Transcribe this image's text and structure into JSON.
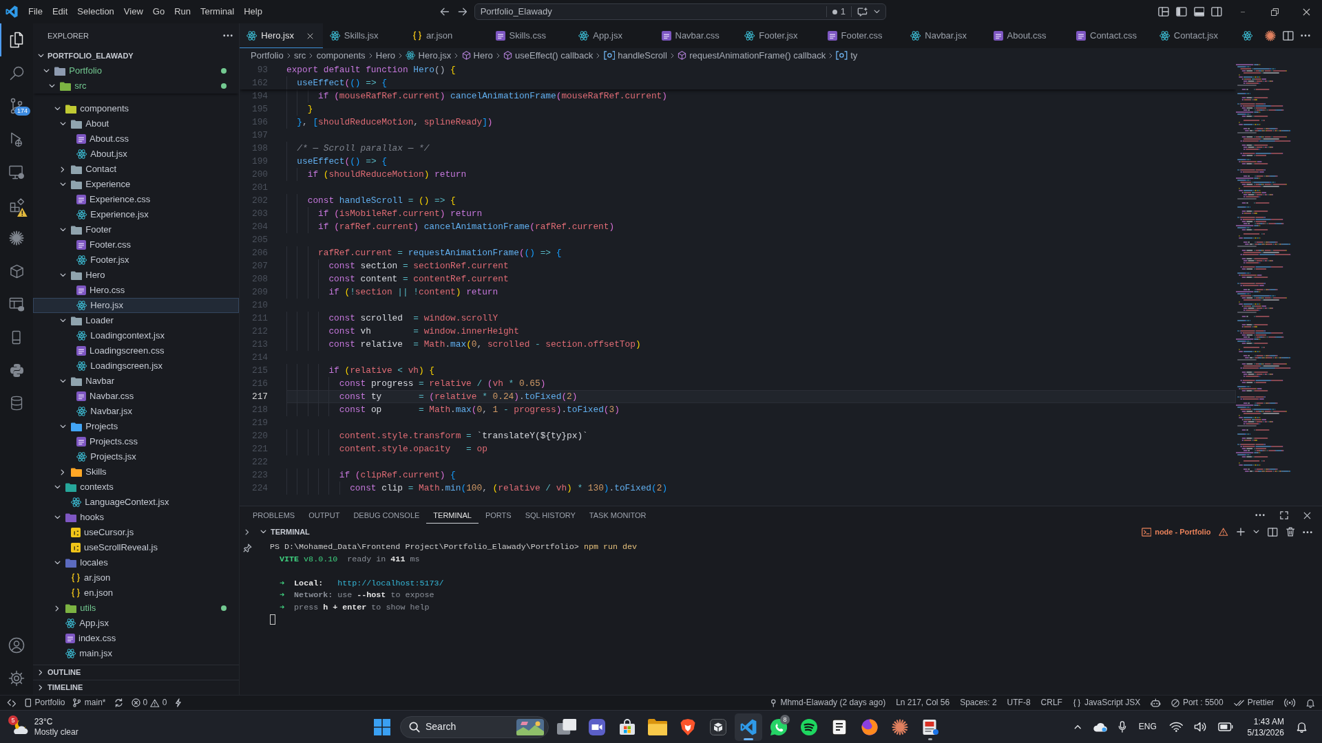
{
  "title_bar": {
    "menu": [
      "File",
      "Edit",
      "Selection",
      "View",
      "Go",
      "Run",
      "Terminal",
      "Help"
    ],
    "command_center": {
      "text": "Portfolio_Elawady",
      "count": "1"
    },
    "panels": [
      {
        "kind": "sidebar-left",
        "on": true
      },
      {
        "kind": "panel",
        "on": true
      },
      {
        "kind": "sidebar-right",
        "on": false
      }
    ]
  },
  "activity_bar": {
    "items": [
      {
        "kind": "explorer",
        "selected": true,
        "alert": false
      },
      {
        "kind": "search",
        "selected": false,
        "alert": false
      },
      {
        "kind": "source-control",
        "selected": false,
        "alert": false,
        "badge": "174"
      },
      {
        "kind": "run-debug",
        "selected": false,
        "alert": false
      },
      {
        "kind": "remote",
        "selected": false,
        "alert": false
      },
      {
        "kind": "extensions",
        "selected": false,
        "alert": true
      },
      {
        "kind": "burst",
        "selected": false,
        "alert": false
      },
      {
        "kind": "box",
        "selected": false,
        "alert": false
      },
      {
        "kind": "table",
        "selected": false,
        "alert": false
      },
      {
        "kind": "device",
        "selected": false,
        "alert": false
      },
      {
        "kind": "python",
        "selected": false,
        "alert": false
      },
      {
        "kind": "database",
        "selected": false,
        "alert": false
      }
    ]
  },
  "sidebar": {
    "title": "EXPLORER",
    "sections": [
      {
        "label": "PORTFOLIO_ELAWADY",
        "expanded": true,
        "tree": [
          {
            "label": "Portfolio",
            "kind": "folder",
            "color": "#8e9bb0",
            "expanded": true,
            "selected": false,
            "changed": true,
            "children": [
              {
                "label": "src",
                "kind": "folder",
                "color": "#7cb342",
                "expanded": true,
                "selected": false,
                "changed": true,
                "children": [
                  {
                    "label": "components",
                    "kind": "folder",
                    "color": "#c0ca33",
                    "expanded": true,
                    "selected": false,
                    "changed": false,
                    "children": [
                      {
                        "label": "About",
                        "kind": "folder",
                        "color": "#90a4ae",
                        "expanded": true,
                        "selected": false,
                        "changed": false,
                        "children": [
                          {
                            "label": "About.css",
                            "kind": "css",
                            "selected": false,
                            "changed": false
                          },
                          {
                            "label": "About.jsx",
                            "kind": "react",
                            "selected": false,
                            "changed": false
                          }
                        ]
                      },
                      {
                        "label": "Contact",
                        "kind": "folder",
                        "color": "#90a4ae",
                        "expanded": false,
                        "selected": false,
                        "changed": false
                      },
                      {
                        "label": "Experience",
                        "kind": "folder",
                        "color": "#90a4ae",
                        "expanded": true,
                        "selected": false,
                        "changed": false,
                        "children": [
                          {
                            "label": "Experience.css",
                            "kind": "css",
                            "selected": false,
                            "changed": false
                          },
                          {
                            "label": "Experience.jsx",
                            "kind": "react",
                            "selected": false,
                            "changed": false
                          }
                        ]
                      },
                      {
                        "label": "Footer",
                        "kind": "folder",
                        "color": "#90a4ae",
                        "expanded": true,
                        "selected": false,
                        "changed": false,
                        "children": [
                          {
                            "label": "Footer.css",
                            "kind": "css",
                            "selected": false,
                            "changed": false
                          },
                          {
                            "label": "Footer.jsx",
                            "kind": "react",
                            "selected": false,
                            "changed": false
                          }
                        ]
                      },
                      {
                        "label": "Hero",
                        "kind": "folder",
                        "color": "#90a4ae",
                        "expanded": true,
                        "selected": false,
                        "changed": false,
                        "children": [
                          {
                            "label": "Hero.css",
                            "kind": "css",
                            "selected": false,
                            "changed": false
                          },
                          {
                            "label": "Hero.jsx",
                            "kind": "react",
                            "selected": true,
                            "changed": false
                          }
                        ]
                      },
                      {
                        "label": "Loader",
                        "kind": "folder",
                        "color": "#90a4ae",
                        "expanded": true,
                        "selected": false,
                        "changed": false,
                        "children": [
                          {
                            "label": "Loadingcontext.jsx",
                            "kind": "react",
                            "selected": false,
                            "changed": false
                          },
                          {
                            "label": "Loadingscreen.css",
                            "kind": "css",
                            "selected": false,
                            "changed": false
                          },
                          {
                            "label": "Loadingscreen.jsx",
                            "kind": "react",
                            "selected": false,
                            "changed": false
                          }
                        ]
                      },
                      {
                        "label": "Navbar",
                        "kind": "folder",
                        "color": "#90a4ae",
                        "expanded": true,
                        "selected": false,
                        "changed": false,
                        "children": [
                          {
                            "label": "Navbar.css",
                            "kind": "css",
                            "selected": false,
                            "changed": false
                          },
                          {
                            "label": "Navbar.jsx",
                            "kind": "react",
                            "selected": false,
                            "changed": false
                          }
                        ]
                      },
                      {
                        "label": "Projects",
                        "kind": "folder",
                        "color": "#42a5f5",
                        "expanded": true,
                        "selected": false,
                        "changed": false,
                        "children": [
                          {
                            "label": "Projects.css",
                            "kind": "css",
                            "selected": false,
                            "changed": false
                          },
                          {
                            "label": "Projects.jsx",
                            "kind": "react",
                            "selected": false,
                            "changed": false
                          }
                        ]
                      },
                      {
                        "label": "Skills",
                        "kind": "folder",
                        "color": "#ffa726",
                        "expanded": false,
                        "selected": false,
                        "changed": false
                      }
                    ]
                  },
                  {
                    "label": "contexts",
                    "kind": "folder",
                    "color": "#26a69a",
                    "expanded": true,
                    "selected": false,
                    "changed": false,
                    "children": [
                      {
                        "label": "LanguageContext.jsx",
                        "kind": "react",
                        "selected": false,
                        "changed": false
                      }
                    ]
                  },
                  {
                    "label": "hooks",
                    "kind": "folder",
                    "color": "#7e57c2",
                    "expanded": true,
                    "selected": false,
                    "changed": false,
                    "children": [
                      {
                        "label": "useCursor.js",
                        "kind": "js",
                        "selected": false,
                        "changed": false
                      },
                      {
                        "label": "useScrollReveal.js",
                        "kind": "js",
                        "selected": false,
                        "changed": false
                      }
                    ]
                  },
                  {
                    "label": "locales",
                    "kind": "folder",
                    "color": "#5c6bc0",
                    "expanded": true,
                    "selected": false,
                    "changed": false,
                    "children": [
                      {
                        "label": "ar.json",
                        "kind": "json",
                        "selected": false,
                        "changed": false
                      },
                      {
                        "label": "en.json",
                        "kind": "json",
                        "selected": false,
                        "changed": false
                      }
                    ]
                  },
                  {
                    "label": "utils",
                    "kind": "folder",
                    "color": "#7cb342",
                    "expanded": false,
                    "selected": false,
                    "changed": true
                  },
                  {
                    "label": "App.jsx",
                    "kind": "react",
                    "selected": false,
                    "changed": false
                  },
                  {
                    "label": "index.css",
                    "kind": "css",
                    "selected": false,
                    "changed": false
                  },
                  {
                    "label": "main.jsx",
                    "kind": "react",
                    "selected": false,
                    "changed": false
                  }
                ]
              }
            ]
          }
        ]
      },
      {
        "label": "OUTLINE",
        "expanded": false
      },
      {
        "label": "TIMELINE",
        "expanded": false
      }
    ]
  },
  "editor": {
    "tabs": [
      {
        "label": "Hero.jsx",
        "kind": "react",
        "selected": true
      },
      {
        "label": "Skills.jsx",
        "kind": "react",
        "selected": false
      },
      {
        "label": "ar.json",
        "kind": "json",
        "selected": false
      },
      {
        "label": "Skills.css",
        "kind": "css",
        "selected": false
      },
      {
        "label": "App.jsx",
        "kind": "react",
        "selected": false
      },
      {
        "label": "Navbar.css",
        "kind": "css",
        "selected": false
      },
      {
        "label": "Footer.jsx",
        "kind": "react",
        "selected": false
      },
      {
        "label": "Footer.css",
        "kind": "css",
        "selected": false
      },
      {
        "label": "Navbar.jsx",
        "kind": "react",
        "selected": false
      },
      {
        "label": "About.css",
        "kind": "css",
        "selected": false
      },
      {
        "label": "Contact.css",
        "kind": "css",
        "selected": false
      },
      {
        "label": "Contact.jsx",
        "kind": "react",
        "selected": false
      },
      {
        "kind": "react",
        "selected": false
      }
    ],
    "breadcrumb": [
      {
        "label": "Portfolio",
        "kind": "folder"
      },
      {
        "label": "src",
        "kind": "folder"
      },
      {
        "label": "components",
        "kind": "folder"
      },
      {
        "label": "Hero",
        "kind": "folder"
      },
      {
        "label": "Hero.jsx",
        "kind": "react"
      },
      {
        "label": "Hero",
        "kind": "function"
      },
      {
        "label": "useEffect() callback",
        "kind": "function"
      },
      {
        "label": "handleScroll",
        "kind": "variable"
      },
      {
        "label": "requestAnimationFrame() callback",
        "kind": "function"
      },
      {
        "label": "ty",
        "kind": "variable"
      }
    ],
    "sticky_lines": [
      {
        "number": "93",
        "current": false,
        "tokens": [
          {
            "kind": "keyword",
            "text": "export default function "
          },
          {
            "kind": "function",
            "text": "Hero"
          },
          {
            "kind": "punctuation",
            "text": "() "
          },
          {
            "kind": "brace1",
            "text": "{"
          }
        ]
      },
      {
        "number": "162",
        "current": false,
        "tokens": [
          {
            "kind": "function",
            "text": "  useEffect"
          },
          {
            "kind": "brace2",
            "text": "("
          },
          {
            "kind": "brace3",
            "text": "()"
          },
          {
            "kind": "operator",
            "text": " => "
          },
          {
            "kind": "brace3",
            "text": "{"
          }
        ]
      }
    ],
    "lines": [
      {
        "number": "194",
        "current": false,
        "tokens": [
          {
            "kind": "keyword",
            "text": "      if "
          },
          {
            "kind": "brace2",
            "text": "("
          },
          {
            "kind": "variable",
            "text": "mouseRafRef.current"
          },
          {
            "kind": "brace2",
            "text": ") "
          },
          {
            "kind": "function",
            "text": "cancelAnimationFrame"
          },
          {
            "kind": "brace2",
            "text": "("
          },
          {
            "kind": "variable",
            "text": "mouseRafRef.current"
          },
          {
            "kind": "brace2",
            "text": ")"
          }
        ]
      },
      {
        "number": "195",
        "current": false,
        "tokens": [
          {
            "kind": "brace1",
            "text": "    }"
          }
        ]
      },
      {
        "number": "196",
        "current": false,
        "tokens": [
          {
            "kind": "brace3",
            "text": "  }"
          },
          {
            "kind": "punctuation",
            "text": ", "
          },
          {
            "kind": "brace3",
            "text": "["
          },
          {
            "kind": "variable",
            "text": "shouldReduceMotion"
          },
          {
            "kind": "punctuation",
            "text": ", "
          },
          {
            "kind": "variable",
            "text": "splineReady"
          },
          {
            "kind": "brace3",
            "text": "]"
          },
          {
            "kind": "brace2",
            "text": ")"
          }
        ]
      },
      {
        "number": "197",
        "current": false
      },
      {
        "number": "198",
        "current": false,
        "tokens": [
          {
            "kind": "comment",
            "text": "  /* — Scroll parallax — */"
          }
        ]
      },
      {
        "number": "199",
        "current": false,
        "tokens": [
          {
            "kind": "function",
            "text": "  useEffect"
          },
          {
            "kind": "brace2",
            "text": "("
          },
          {
            "kind": "brace3",
            "text": "()"
          },
          {
            "kind": "operator",
            "text": " => "
          },
          {
            "kind": "brace3",
            "text": "{"
          }
        ]
      },
      {
        "number": "200",
        "current": false,
        "tokens": [
          {
            "kind": "keyword",
            "text": "    if "
          },
          {
            "kind": "brace1",
            "text": "("
          },
          {
            "kind": "variable",
            "text": "shouldReduceMotion"
          },
          {
            "kind": "brace1",
            "text": ") "
          },
          {
            "kind": "keyword",
            "text": "return"
          }
        ]
      },
      {
        "number": "201",
        "current": false
      },
      {
        "number": "202",
        "current": false,
        "tokens": [
          {
            "kind": "keyword",
            "text": "    const "
          },
          {
            "kind": "function",
            "text": "handleScroll"
          },
          {
            "kind": "operator",
            "text": " = "
          },
          {
            "kind": "brace1",
            "text": "() "
          },
          {
            "kind": "operator",
            "text": "=> "
          },
          {
            "kind": "brace1",
            "text": "{"
          }
        ]
      },
      {
        "number": "203",
        "current": false,
        "tokens": [
          {
            "kind": "keyword",
            "text": "      if "
          },
          {
            "kind": "brace2",
            "text": "("
          },
          {
            "kind": "variable",
            "text": "isMobileRef.current"
          },
          {
            "kind": "brace2",
            "text": ") "
          },
          {
            "kind": "keyword",
            "text": "return"
          }
        ]
      },
      {
        "number": "204",
        "current": false,
        "tokens": [
          {
            "kind": "keyword",
            "text": "      if "
          },
          {
            "kind": "brace2",
            "text": "("
          },
          {
            "kind": "variable",
            "text": "rafRef.current"
          },
          {
            "kind": "brace2",
            "text": ") "
          },
          {
            "kind": "function",
            "text": "cancelAnimationFrame"
          },
          {
            "kind": "brace2",
            "text": "("
          },
          {
            "kind": "variable",
            "text": "rafRef.current"
          },
          {
            "kind": "brace2",
            "text": ")"
          }
        ]
      },
      {
        "number": "205",
        "current": false
      },
      {
        "number": "206",
        "current": false,
        "tokens": [
          {
            "kind": "variable",
            "text": "      rafRef.current"
          },
          {
            "kind": "operator",
            "text": " = "
          },
          {
            "kind": "function",
            "text": "requestAnimationFrame"
          },
          {
            "kind": "brace2",
            "text": "("
          },
          {
            "kind": "brace3",
            "text": "() "
          },
          {
            "kind": "operator",
            "text": "=> "
          },
          {
            "kind": "brace3",
            "text": "{"
          }
        ]
      },
      {
        "number": "207",
        "current": false,
        "tokens": [
          {
            "kind": "keyword",
            "text": "        const "
          },
          {
            "kind": "name",
            "text": "section"
          },
          {
            "kind": "operator",
            "text": " = "
          },
          {
            "kind": "variable",
            "text": "sectionRef.current"
          }
        ]
      },
      {
        "number": "208",
        "current": false,
        "tokens": [
          {
            "kind": "keyword",
            "text": "        const "
          },
          {
            "kind": "name",
            "text": "content"
          },
          {
            "kind": "operator",
            "text": " = "
          },
          {
            "kind": "variable",
            "text": "contentRef.current"
          }
        ]
      },
      {
        "number": "209",
        "current": false,
        "tokens": [
          {
            "kind": "keyword",
            "text": "        if "
          },
          {
            "kind": "brace1",
            "text": "("
          },
          {
            "kind": "operator",
            "text": "!"
          },
          {
            "kind": "variable",
            "text": "section"
          },
          {
            "kind": "operator",
            "text": " || !"
          },
          {
            "kind": "variable",
            "text": "content"
          },
          {
            "kind": "brace1",
            "text": ") "
          },
          {
            "kind": "keyword",
            "text": "return"
          }
        ]
      },
      {
        "number": "210",
        "current": false
      },
      {
        "number": "211",
        "current": false,
        "tokens": [
          {
            "kind": "keyword",
            "text": "        const "
          },
          {
            "kind": "name",
            "text": "scrolled "
          },
          {
            "kind": "operator",
            "text": " = "
          },
          {
            "kind": "variable",
            "text": "window.scrollY"
          }
        ]
      },
      {
        "number": "212",
        "current": false,
        "tokens": [
          {
            "kind": "keyword",
            "text": "        const "
          },
          {
            "kind": "name",
            "text": "vh       "
          },
          {
            "kind": "operator",
            "text": " = "
          },
          {
            "kind": "variable",
            "text": "window.innerHeight"
          }
        ]
      },
      {
        "number": "213",
        "current": false,
        "tokens": [
          {
            "kind": "keyword",
            "text": "        const "
          },
          {
            "kind": "name",
            "text": "relative "
          },
          {
            "kind": "operator",
            "text": " = "
          },
          {
            "kind": "variable",
            "text": "Math"
          },
          {
            "kind": "punctuation",
            "text": "."
          },
          {
            "kind": "function",
            "text": "max"
          },
          {
            "kind": "brace1",
            "text": "("
          },
          {
            "kind": "number",
            "text": "0"
          },
          {
            "kind": "punctuation",
            "text": ", "
          },
          {
            "kind": "variable",
            "text": "scrolled"
          },
          {
            "kind": "operator",
            "text": " - "
          },
          {
            "kind": "variable",
            "text": "section.offsetTop"
          },
          {
            "kind": "brace1",
            "text": ")"
          }
        ]
      },
      {
        "number": "214",
        "current": false
      },
      {
        "number": "215",
        "current": false,
        "tokens": [
          {
            "kind": "keyword",
            "text": "        if "
          },
          {
            "kind": "brace1",
            "text": "("
          },
          {
            "kind": "variable",
            "text": "relative"
          },
          {
            "kind": "operator",
            "text": " < "
          },
          {
            "kind": "variable",
            "text": "vh"
          },
          {
            "kind": "brace1",
            "text": ") {"
          }
        ]
      },
      {
        "number": "216",
        "current": false,
        "tokens": [
          {
            "kind": "keyword",
            "text": "          const "
          },
          {
            "kind": "name",
            "text": "progress"
          },
          {
            "kind": "operator",
            "text": " = "
          },
          {
            "kind": "variable",
            "text": "relative"
          },
          {
            "kind": "operator",
            "text": " / "
          },
          {
            "kind": "brace2",
            "text": "("
          },
          {
            "kind": "variable",
            "text": "vh"
          },
          {
            "kind": "operator",
            "text": " * "
          },
          {
            "kind": "number",
            "text": "0.65"
          },
          {
            "kind": "brace2",
            "text": ")"
          }
        ]
      },
      {
        "number": "217",
        "current": true,
        "tokens": [
          {
            "kind": "keyword",
            "text": "          const "
          },
          {
            "kind": "name",
            "text": "ty      "
          },
          {
            "kind": "operator",
            "text": " = "
          },
          {
            "kind": "brace2",
            "text": "("
          },
          {
            "kind": "variable",
            "text": "relative"
          },
          {
            "kind": "operator",
            "text": " * "
          },
          {
            "kind": "number",
            "text": "0.24"
          },
          {
            "kind": "brace2",
            "text": ")"
          },
          {
            "kind": "punctuation",
            "text": "."
          },
          {
            "kind": "function",
            "text": "toFixed"
          },
          {
            "kind": "brace2",
            "text": "("
          },
          {
            "kind": "number",
            "text": "2"
          },
          {
            "kind": "brace2",
            "text": ")"
          }
        ]
      },
      {
        "number": "218",
        "current": false,
        "tokens": [
          {
            "kind": "keyword",
            "text": "          const "
          },
          {
            "kind": "name",
            "text": "op      "
          },
          {
            "kind": "operator",
            "text": " = "
          },
          {
            "kind": "variable",
            "text": "Math"
          },
          {
            "kind": "punctuation",
            "text": "."
          },
          {
            "kind": "function",
            "text": "max"
          },
          {
            "kind": "brace2",
            "text": "("
          },
          {
            "kind": "number",
            "text": "0"
          },
          {
            "kind": "punctuation",
            "text": ", "
          },
          {
            "kind": "number",
            "text": "1"
          },
          {
            "kind": "operator",
            "text": " - "
          },
          {
            "kind": "variable",
            "text": "progress"
          },
          {
            "kind": "brace2",
            "text": ")"
          },
          {
            "kind": "punctuation",
            "text": "."
          },
          {
            "kind": "function",
            "text": "toFixed"
          },
          {
            "kind": "brace2",
            "text": "("
          },
          {
            "kind": "number",
            "text": "3"
          },
          {
            "kind": "brace2",
            "text": ")"
          }
        ]
      },
      {
        "number": "219",
        "current": false
      },
      {
        "number": "220",
        "current": false,
        "tokens": [
          {
            "kind": "variable",
            "text": "          content.style.transform"
          },
          {
            "kind": "operator",
            "text": " = "
          },
          {
            "kind": "string",
            "text": "`translateY(${ty}px)`"
          }
        ]
      },
      {
        "number": "221",
        "current": false,
        "tokens": [
          {
            "kind": "variable",
            "text": "          content.style.opacity"
          },
          {
            "kind": "operator",
            "text": "   = "
          },
          {
            "kind": "variable",
            "text": "op"
          }
        ]
      },
      {
        "number": "222",
        "current": false
      },
      {
        "number": "223",
        "current": false,
        "tokens": [
          {
            "kind": "keyword",
            "text": "          if "
          },
          {
            "kind": "brace2",
            "text": "("
          },
          {
            "kind": "variable",
            "text": "clipRef.current"
          },
          {
            "kind": "brace2",
            "text": ") "
          },
          {
            "kind": "brace3",
            "text": "{"
          }
        ]
      },
      {
        "number": "224",
        "current": false,
        "tokens": [
          {
            "kind": "keyword",
            "text": "            const "
          },
          {
            "kind": "name",
            "text": "clip"
          },
          {
            "kind": "operator",
            "text": " = "
          },
          {
            "kind": "variable",
            "text": "Math"
          },
          {
            "kind": "punctuation",
            "text": "."
          },
          {
            "kind": "function",
            "text": "min"
          },
          {
            "kind": "brace3",
            "text": "("
          },
          {
            "kind": "number",
            "text": "100"
          },
          {
            "kind": "punctuation",
            "text": ", "
          },
          {
            "kind": "brace1",
            "text": "("
          },
          {
            "kind": "variable",
            "text": "relative"
          },
          {
            "kind": "operator",
            "text": " / "
          },
          {
            "kind": "variable",
            "text": "vh"
          },
          {
            "kind": "brace1",
            "text": ")"
          },
          {
            "kind": "operator",
            "text": " * "
          },
          {
            "kind": "number",
            "text": "130"
          },
          {
            "kind": "brace3",
            "text": ")"
          },
          {
            "kind": "punctuation",
            "text": "."
          },
          {
            "kind": "function",
            "text": "toFixed"
          },
          {
            "kind": "brace3",
            "text": "("
          },
          {
            "kind": "number",
            "text": "2"
          },
          {
            "kind": "brace3",
            "text": ")"
          }
        ]
      }
    ]
  },
  "panel": {
    "tabs": [
      {
        "label": "PROBLEMS",
        "selected": false
      },
      {
        "label": "OUTPUT",
        "selected": false
      },
      {
        "label": "DEBUG CONSOLE",
        "selected": false
      },
      {
        "label": "TERMINAL",
        "selected": true
      },
      {
        "label": "PORTS",
        "selected": false
      },
      {
        "label": "SQL HISTORY",
        "selected": false
      },
      {
        "label": "TASK MONITOR",
        "selected": false
      }
    ],
    "terminal": {
      "title": "TERMINAL",
      "expanded": true,
      "instance": "node - Portfolio",
      "warning": true,
      "cursor": true,
      "lines": [
        {
          "kind": "prompt",
          "segments": [
            {
              "kind": "prompt",
              "text": "PS D:\\Mohamed_Data\\Frontend Project\\Portfolio_Elawady\\Portfolio> "
            },
            {
              "kind": "command",
              "text": "npm run dev"
            }
          ]
        },
        {
          "kind": "output",
          "segments": [
            {
              "kind": "brand",
              "text": "  VITE"
            },
            {
              "kind": "version",
              "text": " v8.0.10"
            },
            {
              "kind": "dim",
              "text": "  ready in "
            },
            {
              "kind": "strong",
              "text": "411"
            },
            {
              "kind": "dim",
              "text": " ms"
            }
          ]
        },
        {
          "kind": "blank"
        },
        {
          "kind": "output",
          "segments": [
            {
              "kind": "arrow",
              "text": "  ➜  "
            },
            {
              "kind": "strong",
              "text": "Local:"
            },
            {
              "kind": "url",
              "text": "   http://localhost:5173/"
            }
          ]
        },
        {
          "kind": "output",
          "segments": [
            {
              "kind": "arrow",
              "text": "  ➜  "
            },
            {
              "kind": "dim-strong",
              "text": "Network:"
            },
            {
              "kind": "dim",
              "text": " use "
            },
            {
              "kind": "strong",
              "text": "--host"
            },
            {
              "kind": "dim",
              "text": " to expose"
            }
          ]
        },
        {
          "kind": "output",
          "segments": [
            {
              "kind": "arrow",
              "text": "  ➜  "
            },
            {
              "kind": "dim",
              "text": "press "
            },
            {
              "kind": "strong",
              "text": "h + enter"
            },
            {
              "kind": "dim",
              "text": " to show help"
            }
          ]
        }
      ]
    }
  },
  "status_bar": {
    "left": [
      {
        "kind": "remote"
      },
      {
        "kind": "project",
        "text": "Portfolio"
      },
      {
        "kind": "branch",
        "text": "main*"
      },
      {
        "kind": "sync"
      },
      {
        "kind": "problems",
        "errors": "0",
        "warnings": "0"
      },
      {
        "kind": "lightning"
      }
    ],
    "right": [
      {
        "kind": "blame",
        "text": "Mhmd-Elawady (2 days ago)"
      },
      {
        "kind": "plain",
        "text": "Ln 217, Col 56"
      },
      {
        "kind": "plain",
        "text": "Spaces: 2"
      },
      {
        "kind": "plain",
        "text": "UTF-8"
      },
      {
        "kind": "plain",
        "text": "CRLF"
      },
      {
        "kind": "language",
        "text": "JavaScript JSX"
      },
      {
        "kind": "robot"
      },
      {
        "kind": "port",
        "text": "Port : 5500"
      },
      {
        "kind": "prettier",
        "text": "Prettier"
      },
      {
        "kind": "broadcast"
      },
      {
        "kind": "bell"
      }
    ]
  },
  "taskbar": {
    "weather": {
      "badge": "5",
      "temperature": "23°C",
      "condition": "Mostly clear"
    },
    "apps": [
      {
        "kind": "start",
        "active": false,
        "running": false
      },
      {
        "kind": "search",
        "placeholder": "Search",
        "active": false
      },
      {
        "kind": "task-view",
        "active": false,
        "running": false
      },
      {
        "kind": "video",
        "active": false,
        "running": false
      },
      {
        "kind": "store",
        "active": false,
        "running": false
      },
      {
        "kind": "files",
        "active": false,
        "running": false
      },
      {
        "kind": "shield",
        "active": false,
        "running": false
      },
      {
        "kind": "cube",
        "active": false,
        "running": false
      },
      {
        "kind": "vscode",
        "active": true,
        "running": true
      },
      {
        "kind": "chat",
        "active": false,
        "running": false,
        "badge": "8"
      },
      {
        "kind": "music",
        "active": false,
        "running": false
      },
      {
        "kind": "notes",
        "active": false,
        "running": false
      },
      {
        "kind": "browser",
        "active": false,
        "running": false
      },
      {
        "kind": "sparkle",
        "active": false,
        "running": false
      },
      {
        "kind": "tool",
        "active": false,
        "running": true
      }
    ],
    "tray": [
      {
        "kind": "chevron"
      },
      {
        "kind": "cloud"
      },
      {
        "kind": "mic"
      },
      {
        "kind": "language",
        "text": "ENG"
      },
      {
        "kind": "wifi"
      },
      {
        "kind": "volume"
      },
      {
        "kind": "battery"
      },
      {
        "kind": "clock",
        "time": "1:43 AM",
        "date": "5/13/2026"
      },
      {
        "kind": "bell"
      }
    ]
  }
}
